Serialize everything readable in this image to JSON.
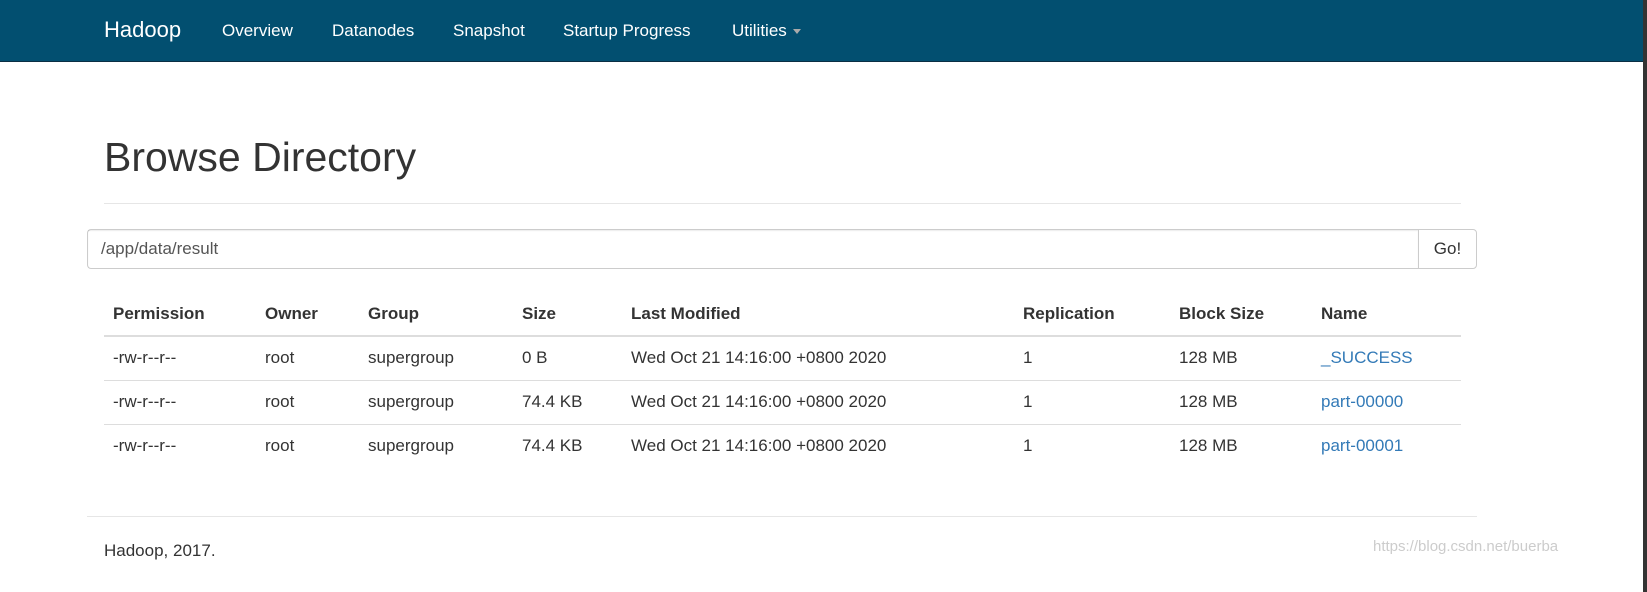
{
  "navbar": {
    "brand": "Hadoop",
    "items": [
      "Overview",
      "Datanodes",
      "Snapshot",
      "Startup Progress",
      "Utilities"
    ],
    "bg_color": "#024f70"
  },
  "page_title": "Browse Directory",
  "path_input": {
    "value": "/app/data/result",
    "go_label": "Go!"
  },
  "table": {
    "headers": [
      "Permission",
      "Owner",
      "Group",
      "Size",
      "Last Modified",
      "Replication",
      "Block Size",
      "Name"
    ],
    "rows": [
      [
        "-rw-r--r--",
        "root",
        "supergroup",
        "0 B",
        "Wed Oct 21 14:16:00 +0800 2020",
        "1",
        "128 MB",
        "_SUCCESS"
      ],
      [
        "-rw-r--r--",
        "root",
        "supergroup",
        "74.4 KB",
        "Wed Oct 21 14:16:00 +0800 2020",
        "1",
        "128 MB",
        "part-00000"
      ],
      [
        "-rw-r--r--",
        "root",
        "supergroup",
        "74.4 KB",
        "Wed Oct 21 14:16:00 +0800 2020",
        "1",
        "128 MB",
        "part-00001"
      ]
    ]
  },
  "footer": "Hadoop, 2017.",
  "watermark": "https://blog.csdn.net/buerba"
}
